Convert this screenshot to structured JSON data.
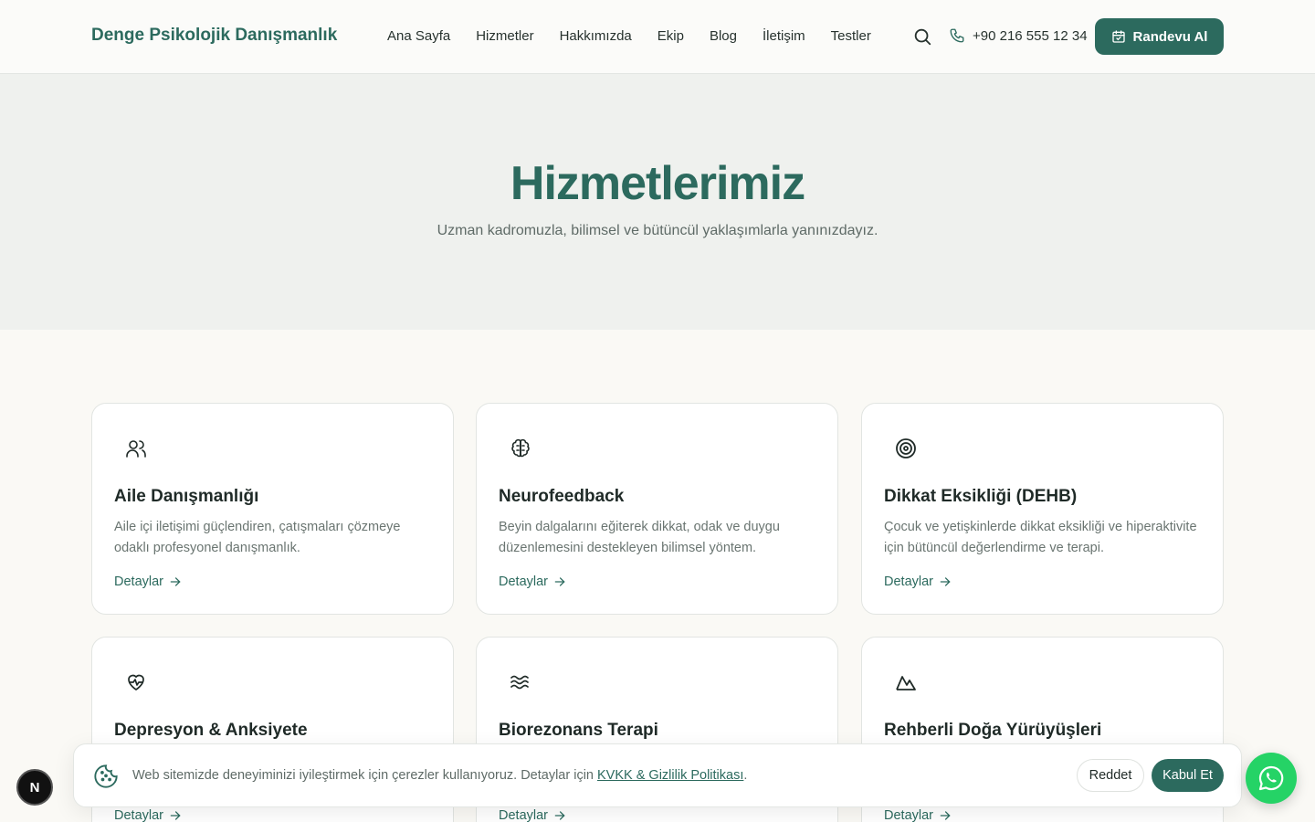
{
  "header": {
    "brand": "Denge Psikolojik Danışmanlık",
    "nav": [
      "Ana Sayfa",
      "Hizmetler",
      "Hakkımızda",
      "Ekip",
      "Blog",
      "İletişim",
      "Testler"
    ],
    "phone": "+90 216 555 12 34",
    "cta_label": "Randevu Al"
  },
  "hero": {
    "title": "Hizmetlerimiz",
    "subtitle": "Uzman kadromuzla, bilimsel ve bütüncül yaklaşımlarla yanınızdayız."
  },
  "services": [
    {
      "title": "Aile Danışmanlığı",
      "desc": "Aile içi iletişimi güçlendiren, çatışmaları çözmeye odaklı profesyonel danışmanlık.",
      "link": "Detaylar",
      "icon": "users-icon"
    },
    {
      "title": "Neurofeedback",
      "desc": "Beyin dalgalarını eğiterek dikkat, odak ve duygu düzenlemesini destekleyen bilimsel yöntem.",
      "link": "Detaylar",
      "icon": "brain-icon"
    },
    {
      "title": "Dikkat Eksikliği (DEHB)",
      "desc": "Çocuk ve yetişkinlerde dikkat eksikliği ve hiperaktivite için bütüncül değerlendirme ve terapi.",
      "link": "Detaylar",
      "icon": "target-icon"
    },
    {
      "title": "Depresyon & Anksiyete",
      "desc": "",
      "link": "Detaylar",
      "icon": "heart-pulse-icon"
    },
    {
      "title": "Biorezonans Terapi",
      "desc": "",
      "link": "Detaylar",
      "icon": "waves-icon"
    },
    {
      "title": "Rehberli Doğa Yürüyüşleri",
      "desc": "",
      "link": "Detaylar",
      "icon": "mountain-icon"
    }
  ],
  "cookie": {
    "text": "Web sitemizde deneyiminizi iyileştirmek için çerezler kullanıyoruz. Detaylar için ",
    "link": "KVKK & Gizlilik Politikası",
    "suffix": ".",
    "reject": "Reddet",
    "accept": "Kabul Et"
  },
  "badge": "N",
  "colors": {
    "accent": "#2c6a5e",
    "whatsapp": "#25d366"
  }
}
